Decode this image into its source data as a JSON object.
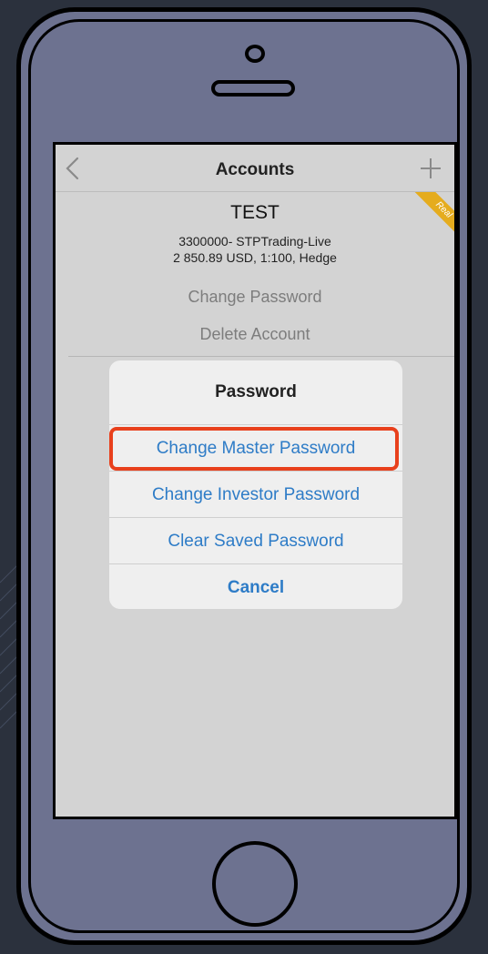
{
  "navbar": {
    "title": "Accounts",
    "back_icon": "chevron-left-icon",
    "add_icon": "plus-icon"
  },
  "badge": {
    "label": "Real",
    "color": "#e5ac1e"
  },
  "account": {
    "name": "TEST",
    "server": "3300000- STPTrading-Live",
    "details": "2 850.89 USD, 1:100, Hedge",
    "change_password": "Change Password",
    "delete_account": "Delete Account"
  },
  "password_sheet": {
    "title": "Password",
    "options": [
      "Change Master Password",
      "Change Investor Password",
      "Clear Saved Password"
    ],
    "cancel": "Cancel",
    "highlight_color": "#e8401c",
    "link_color": "#2e7cc7"
  }
}
